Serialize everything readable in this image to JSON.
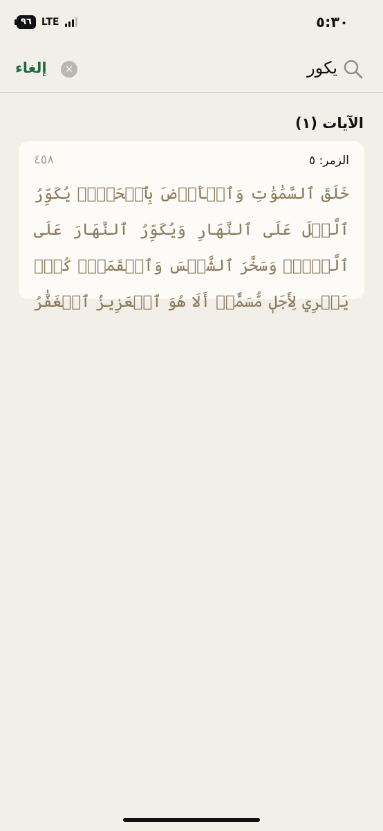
{
  "status_bar": {
    "time": "٥:٣٠",
    "network": "LTE",
    "battery": "٩٦"
  },
  "search": {
    "query": "يكور",
    "cancel_label": "إلغاء",
    "icon": "search-icon",
    "clear_icon": "close-circle-icon"
  },
  "results": {
    "section_title": "الآيات (١)",
    "items": [
      {
        "reference": "الزمر: ٥",
        "page": "٤٥٨",
        "text": "خَلَقَ ٱلسَّمَٰوَٰتِ وَٱلۡأَرۡضَ بِٱلۡحَقِّۖ يُكَوِّرُ ٱلَّيۡلَ عَلَى ٱلنَّهَارِ وَيُكَوِّرُ ٱلنَّهَارَ عَلَى ٱلَّيۡلِۖ وَسَخَّرَ ٱلشَّمۡسَ وَٱلۡقَمَرَۖ كُلّٞ يَجۡرِي لِأَجَلٖ مُّسَمًّىۗ أَلَا هُوَ ٱلۡعَزِيزُ ٱلۡغَفَّٰرُ"
      }
    ]
  },
  "colors": {
    "background": "#f2efe8",
    "card": "#fcfbf8",
    "accent_green": "#1f6b3f",
    "verse_text": "#8b7a5c",
    "page_number": "#a9a294"
  }
}
